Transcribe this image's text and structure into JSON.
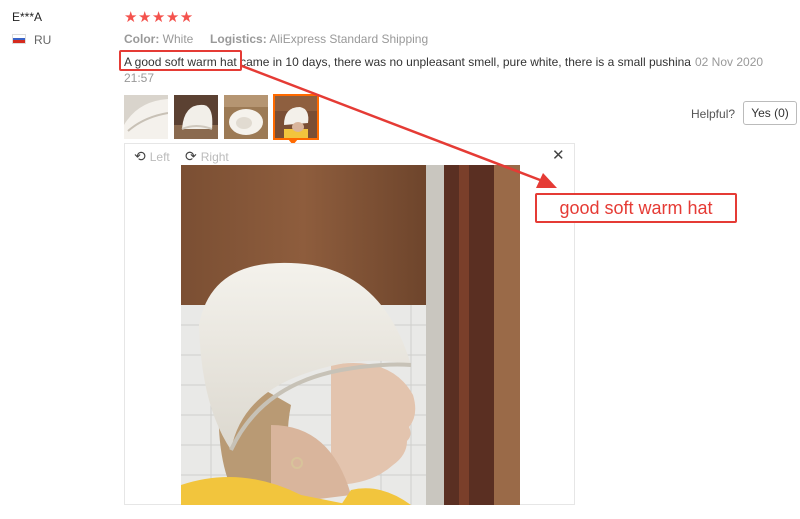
{
  "reviewer": {
    "name": "E***A",
    "country": "RU",
    "flag_icon": "russia-flag-icon"
  },
  "review": {
    "stars": "★★★★★",
    "rating": 5,
    "star_color": "#f4524d",
    "color_label": "Color:",
    "color_value": "White",
    "logistics_label": "Logistics:",
    "logistics_value": "AliExpress Standard Shipping",
    "highlight_text": "A good soft warm hat",
    "rest_text": " came in 10 days, there was no unpleasant smell, pure white, there is a small pushina",
    "date": "02 Nov 2020 21:57"
  },
  "helpful": {
    "label": "Helpful?",
    "yes_button": "Yes (0)"
  },
  "viewer": {
    "rotate_left": "Left",
    "rotate_right": "Right",
    "close_icon": "close-icon",
    "thumbnail_count": 4,
    "selected_thumbnail": 4
  },
  "annotation": {
    "callout_text": "good soft warm hat",
    "accent_color": "#e53b35"
  }
}
